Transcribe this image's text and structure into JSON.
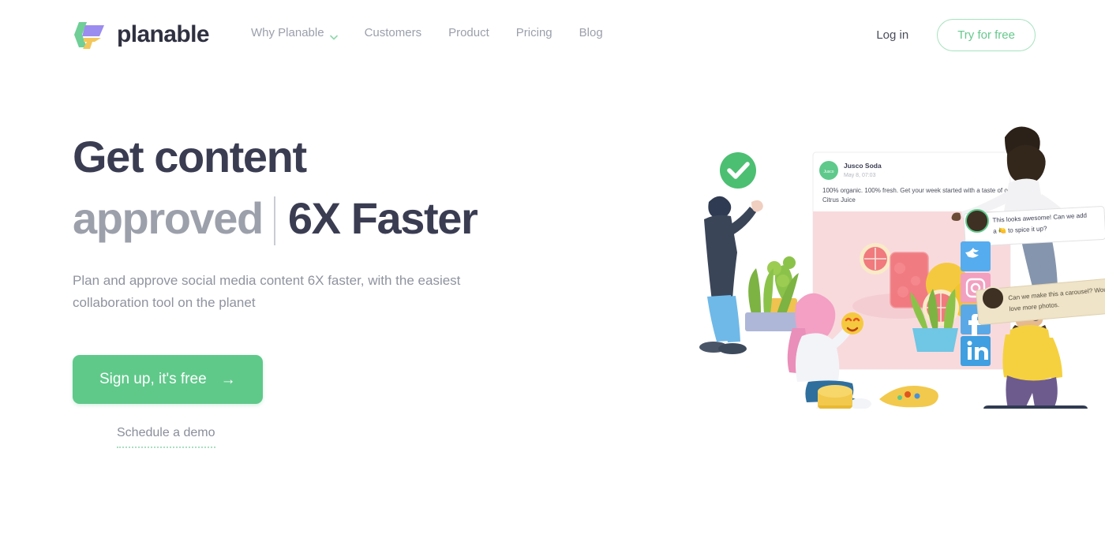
{
  "brand": {
    "name": "planable",
    "logo_icon": "planable-arrow-logo",
    "colors": {
      "green": "#64c98e",
      "purple": "#9b8cf0",
      "yellow": "#f3c75c"
    }
  },
  "nav": {
    "items": [
      {
        "label": "Why Planable",
        "has_dropdown": true,
        "chevron_icon": "chevron-down-icon"
      },
      {
        "label": "Customers",
        "has_dropdown": false
      },
      {
        "label": "Product",
        "has_dropdown": false
      },
      {
        "label": "Pricing",
        "has_dropdown": false
      },
      {
        "label": "Blog",
        "has_dropdown": false
      }
    ]
  },
  "header_actions": {
    "login_label": "Log in",
    "try_label": "Try for free"
  },
  "hero": {
    "headline_line1": "Get content",
    "headline_typed_word": "approved",
    "headline_line2_rest": "6X Faster",
    "subtitle": "Plan and approve social media content 6X faster, with the easiest collaboration tool on the planet",
    "cta_label": "Sign up, it's free",
    "cta_arrow": "→",
    "demo_label": "Schedule a demo"
  },
  "illustration": {
    "approved_badge_icon": "green-check-circle-icon",
    "post_card": {
      "avatar_label": "Jusco",
      "author": "Jusco Soda",
      "timestamp": "May 8, 07:03",
      "body": "100% organic. 100% fresh. Get your week started with a taste of our Citrus Juice",
      "image_alt": "citrus juice grapefruit photo",
      "image_bg": "#f8dadd"
    },
    "comments": [
      {
        "text": "This looks awesome! Can we add a 🍋 to spice it up?",
        "bubble_color": "#ffffff"
      },
      {
        "text": "Can we make this a carousel? Would love more photos.",
        "bubble_color": "#efe3c8"
      }
    ],
    "social_icons": [
      {
        "name": "twitter-icon",
        "color": "#55acee"
      },
      {
        "name": "instagram-icon",
        "color": "#f2a0c0"
      },
      {
        "name": "facebook-icon",
        "color": "#5aa9e6"
      },
      {
        "name": "linkedin-icon",
        "color": "#3f9fe0"
      }
    ],
    "characters": [
      "person-pointing-left",
      "person-standing-on-blocks",
      "person-sitting-with-emoji",
      "person-on-skateboard"
    ],
    "props": [
      "potted-plant-left",
      "potted-plant-right",
      "coin-stack",
      "yellow-skateboard-deck"
    ]
  }
}
